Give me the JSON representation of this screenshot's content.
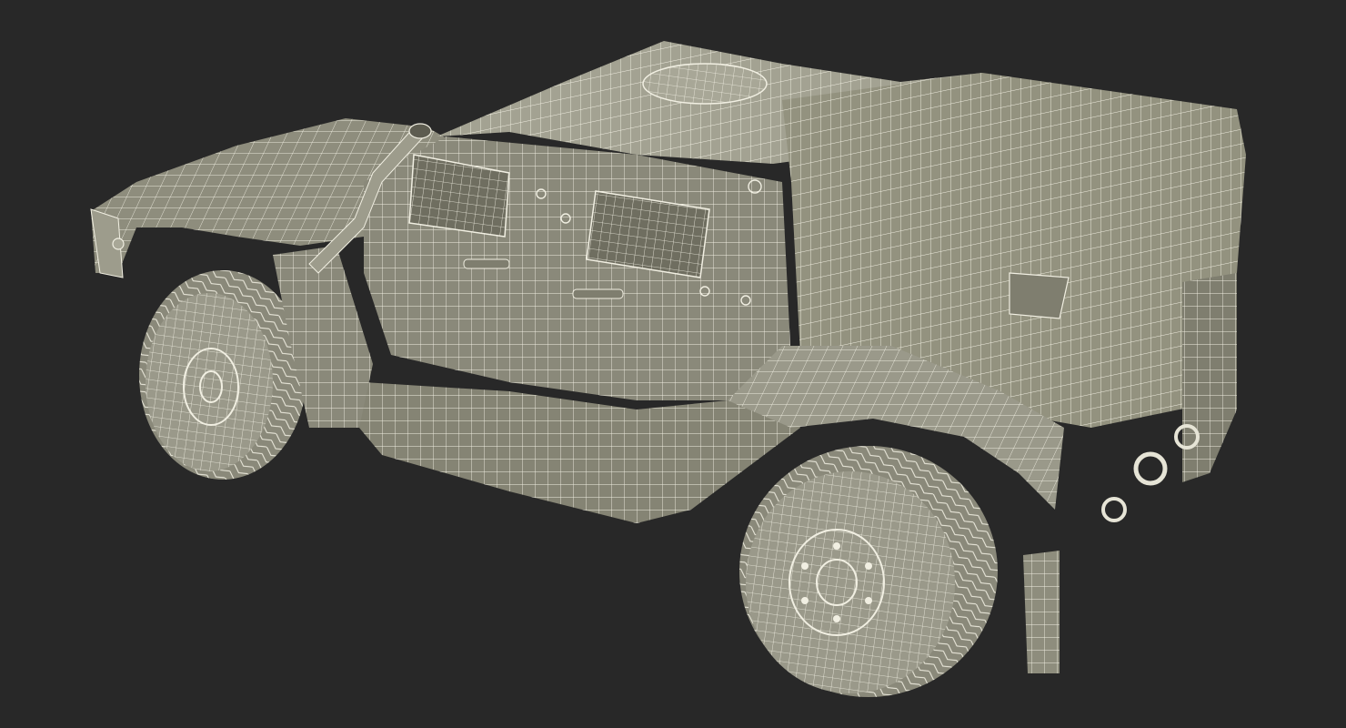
{
  "scene": {
    "background": "#282828",
    "subject": "armored-vehicle-wireframe",
    "colors": {
      "surface": "#8e8d7d",
      "surface_dark": "#6f6e60",
      "surface_light": "#a3a292",
      "wire": "#f1efe2",
      "tire": "#9a998a"
    }
  }
}
